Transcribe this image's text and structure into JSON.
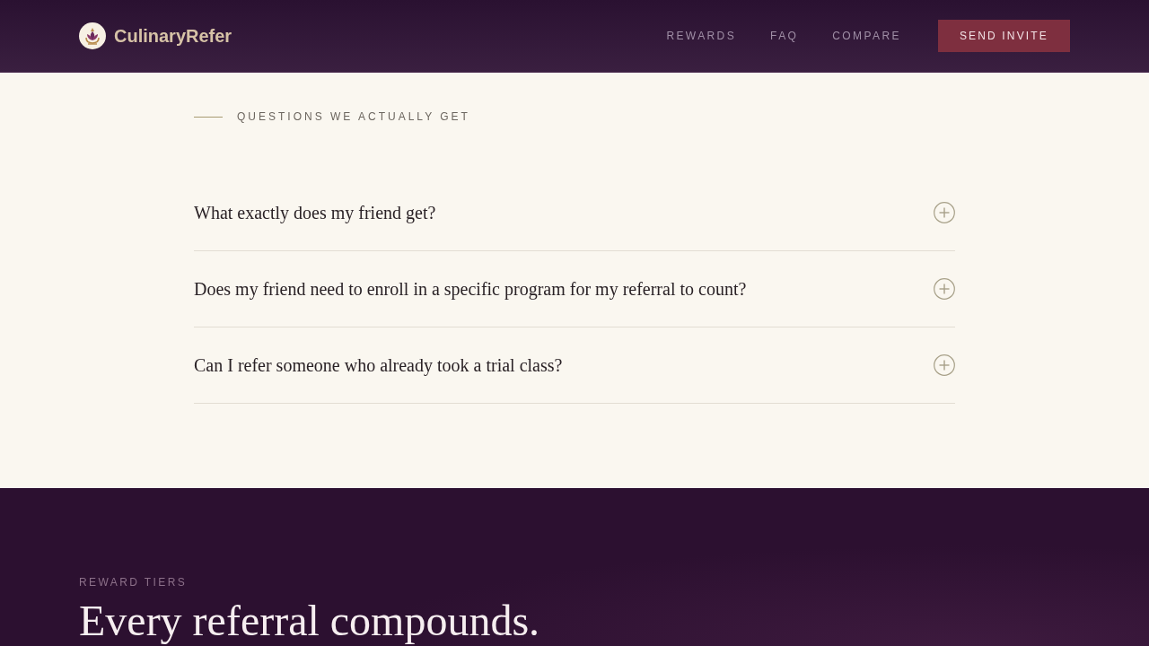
{
  "header": {
    "brand": "CulinaryRefer",
    "links": [
      "REWARDS",
      "FAQ",
      "COMPARE"
    ],
    "cta": "SEND INVITE"
  },
  "faq": {
    "eyebrow": "QUESTIONS WE ACTUALLY GET",
    "items": [
      {
        "question": "What exactly does my friend get?",
        "expanded": false
      },
      {
        "question": "Does my friend need to enroll in a specific program for my referral to count?",
        "expanded": false
      },
      {
        "question": "Can I refer someone who already took a trial class?",
        "expanded": false
      }
    ]
  },
  "tiers": {
    "eyebrow": "REWARD TIERS",
    "heading": "Every referral compounds."
  }
}
